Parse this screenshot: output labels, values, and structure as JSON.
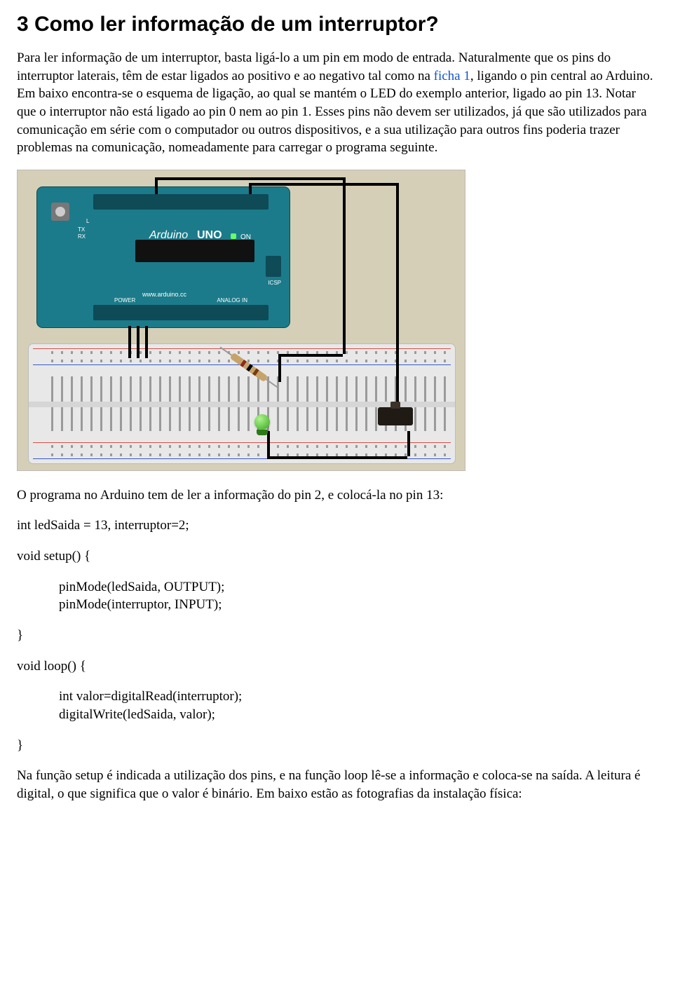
{
  "heading": "3 Como ler informação de um interruptor?",
  "p1_a": "Para ler informação de um interruptor, basta ligá-lo a um pin em modo de entrada. Naturalmente que os pins do interruptor laterais, têm de estar ligados ao positivo e ao negativo tal como na ",
  "link1": "ficha 1",
  "p1_b": ", ligando o pin central ao Arduino. Em baixo encontra-se o esquema de ligação, ao qual se mantém o LED do exemplo anterior, ligado ao pin 13. Notar que o interruptor não está ligado ao pin 0 nem ao pin 1. Esses pins não devem ser utilizados, já que são utilizados para comunicação em série com o computador ou outros dispositivos, e a sua utilização para outros fins poderia trazer problemas na comunicação, nomeadamente para carregar o programa seguinte.",
  "p2": "O programa no Arduino tem de ler a informação do pin 2, e colocá-la no pin 13:",
  "code": {
    "l1": "int ledSaida = 13, interruptor=2;",
    "l2": "void setup() {",
    "l3": "pinMode(ledSaida, OUTPUT);",
    "l4": "pinMode(interruptor, INPUT);",
    "l5": "}",
    "l6": "void loop() {",
    "l7": "int valor=digitalRead(interruptor);",
    "l8": "digitalWrite(ledSaida, valor);",
    "l9": "}"
  },
  "p3": "Na função setup é indicada a utilização dos pins, e na função loop lê-se a informação e coloca-se na saída. A leitura é digital, o que significa que o valor é binário. Em baixo estão as fotografias da instalação física:",
  "board": {
    "brand": "Arduino",
    "model": "UNO",
    "on": "ON",
    "url": "www.arduino.cc",
    "analog": "ANALOG IN",
    "power": "POWER",
    "icsp": "ICSP",
    "txrx": "TX\nRX",
    "l": "L"
  }
}
